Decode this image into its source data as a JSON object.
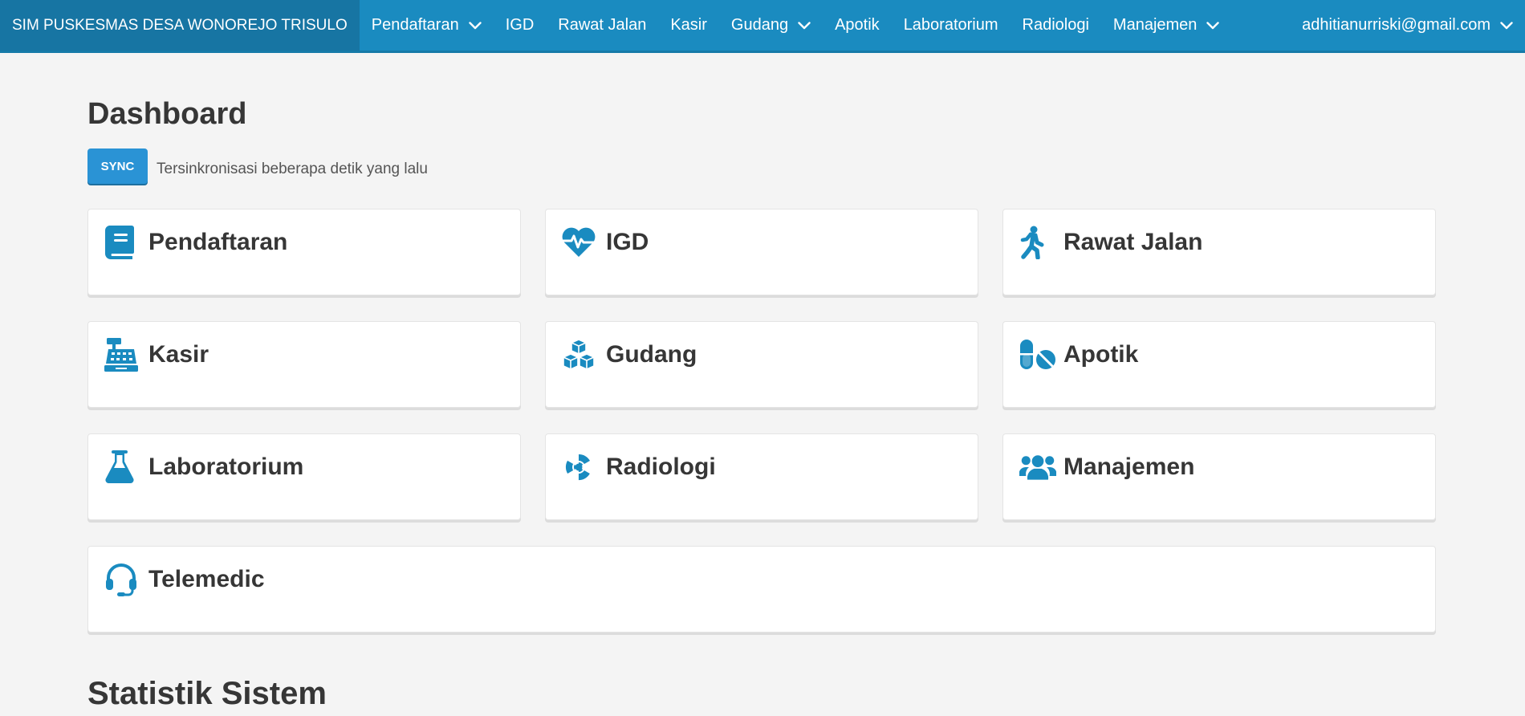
{
  "navbar": {
    "brand": "SIM PUSKESMAS DESA WONOREJO TRISULO",
    "items": [
      {
        "label": "Pendaftaran",
        "dropdown": true
      },
      {
        "label": "IGD",
        "dropdown": false
      },
      {
        "label": "Rawat Jalan",
        "dropdown": false
      },
      {
        "label": "Kasir",
        "dropdown": false
      },
      {
        "label": "Gudang",
        "dropdown": true
      },
      {
        "label": "Apotik",
        "dropdown": false
      },
      {
        "label": "Laboratorium",
        "dropdown": false
      },
      {
        "label": "Radiologi",
        "dropdown": false
      },
      {
        "label": "Manajemen",
        "dropdown": true
      }
    ],
    "user": "adhitianurriski@gmail.com"
  },
  "dashboard": {
    "title": "Dashboard",
    "sync_label": "SYNC",
    "sync_status": "Tersinkronisasi beberapa detik yang lalu"
  },
  "cards": [
    {
      "label": "Pendaftaran",
      "icon": "book-icon"
    },
    {
      "label": "IGD",
      "icon": "heartbeat-icon"
    },
    {
      "label": "Rawat Jalan",
      "icon": "walking-icon"
    },
    {
      "label": "Kasir",
      "icon": "cash-register-icon"
    },
    {
      "label": "Gudang",
      "icon": "cubes-icon"
    },
    {
      "label": "Apotik",
      "icon": "pills-icon"
    },
    {
      "label": "Laboratorium",
      "icon": "flask-icon"
    },
    {
      "label": "Radiologi",
      "icon": "radiation-icon"
    },
    {
      "label": "Manajemen",
      "icon": "users-icon"
    },
    {
      "label": "Telemedic",
      "icon": "headset-icon"
    }
  ],
  "statistics": {
    "title": "Statistik Sistem"
  },
  "colors": {
    "navbar": "#1a8bc0",
    "brand_bg": "#1775a3",
    "icon": "#1a8bc0",
    "sync_button": "#2a93d5",
    "background": "#f4f4f4"
  }
}
